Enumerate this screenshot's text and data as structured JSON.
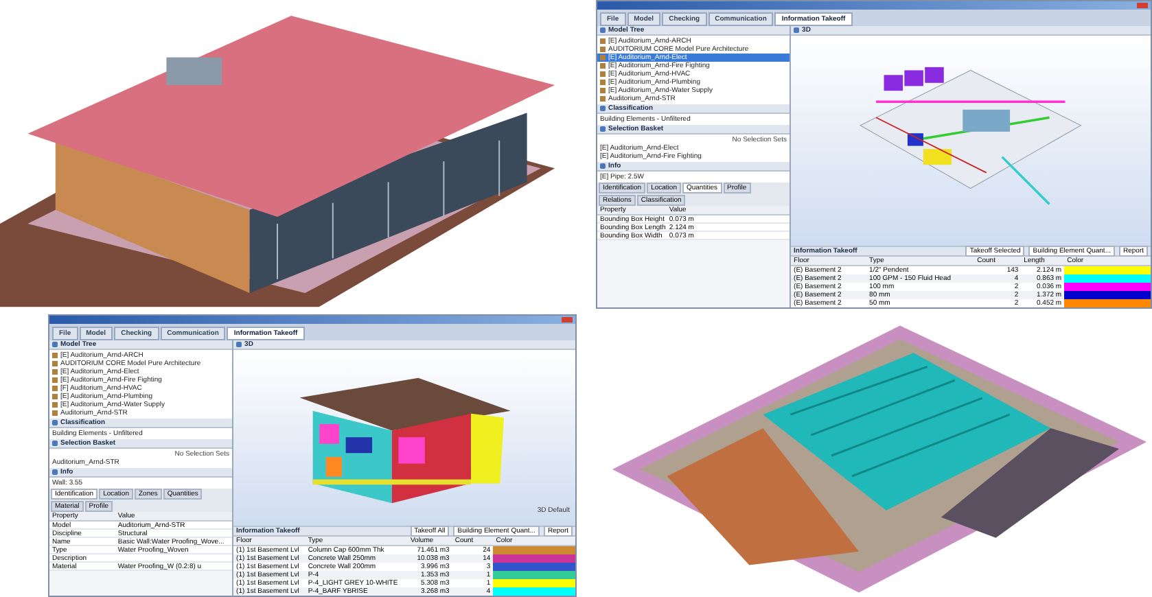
{
  "windows": [
    {
      "kind": "mep",
      "tabs": [
        {
          "label": "File",
          "selected": false
        },
        {
          "label": "Model",
          "selected": false
        },
        {
          "label": "Checking",
          "selected": false
        },
        {
          "label": "Communication",
          "selected": false
        },
        {
          "label": "Information Takeoff",
          "selected": true
        }
      ],
      "model_tree": {
        "title": "Model Tree",
        "items": [
          {
            "label": "[E] Auditorium_Arnd-ARCH",
            "selected": false
          },
          {
            "label": "AUDITORIUM CORE Model Pure Architecture",
            "selected": false
          },
          {
            "label": "[E] Auditorium_Arnd-Elect",
            "selected": true
          },
          {
            "label": "[E] Auditorium_Arnd-Fire Fighting",
            "selected": false
          },
          {
            "label": "[E] Auditorium_Arnd-HVAC",
            "selected": false
          },
          {
            "label": "[E] Auditorium_Arnd-Plumbing",
            "selected": false
          },
          {
            "label": "[E] Auditorium_Arnd-Water Supply",
            "selected": false
          },
          {
            "label": "Auditorium_Arnd-STR",
            "selected": false
          }
        ]
      },
      "classification": {
        "title": "Classification",
        "item": "Building Elements - Unfiltered"
      },
      "selection_basket": {
        "title": "Selection Basket",
        "filter": "No Selection Sets",
        "items": [
          "[E] Auditorium_Arnd-Elect",
          "[E] Auditorium_Arnd-Fire Fighting"
        ]
      },
      "info": {
        "title": "Info",
        "object": "[E] Pipe: 2.5W",
        "tabs": [
          {
            "label": "Identification",
            "selected": false
          },
          {
            "label": "Location",
            "selected": false
          },
          {
            "label": "Quantities",
            "selected": true
          },
          {
            "label": "Profile",
            "selected": false
          },
          {
            "label": "Relations",
            "selected": false
          },
          {
            "label": "Classification",
            "selected": false
          }
        ],
        "columns": [
          "Property",
          "Value"
        ],
        "rows": [
          [
            "Bounding Box Height",
            "0.073 m"
          ],
          [
            "Bounding Box Length",
            "2.124 m"
          ],
          [
            "Bounding Box Width",
            "0.073 m"
          ]
        ]
      },
      "view": {
        "title": "3D"
      },
      "takeoff": {
        "title": "Information Takeoff",
        "toolbar": [
          "Takeoff Selected",
          "Building Element Quant...",
          "Report"
        ],
        "columns": [
          "Floor",
          "Type",
          "Count",
          "Length",
          "Color"
        ],
        "rows": [
          {
            "cells": [
              "(E) Basement 2",
              "1/2\" Pendent",
              "143",
              "2.124 m"
            ],
            "color": "#ffff00"
          },
          {
            "cells": [
              "(E) Basement 2",
              "100 GPM - 150 Fluid Head",
              "4",
              "0.863 m"
            ],
            "color": "#00ffff"
          },
          {
            "cells": [
              "(E) Basement 2",
              "100 mm",
              "2",
              "0.036 m"
            ],
            "color": "#ff00ff"
          },
          {
            "cells": [
              "(E) Basement 2",
              "80 mm",
              "2",
              "1.372 m"
            ],
            "color": "#0000cc"
          },
          {
            "cells": [
              "(E) Basement 2",
              "50 mm",
              "2",
              "0.452 m"
            ],
            "color": "#ff8800"
          }
        ]
      }
    },
    {
      "kind": "building",
      "tabs": [
        {
          "label": "File",
          "selected": false
        },
        {
          "label": "Model",
          "selected": false
        },
        {
          "label": "Checking",
          "selected": false
        },
        {
          "label": "Communication",
          "selected": false
        },
        {
          "label": "Information Takeoff",
          "selected": true
        }
      ],
      "model_tree": {
        "title": "Model Tree",
        "items": [
          {
            "label": "[E] Auditorium_Arnd-ARCH",
            "selected": false
          },
          {
            "label": "AUDITORIUM CORE Model Pure Architecture",
            "selected": false
          },
          {
            "label": "[E] Auditorium_Arnd-Elect",
            "selected": false
          },
          {
            "label": "[E] Auditorium_Arnd-Fire Fighting",
            "selected": false
          },
          {
            "label": "[F] Auditorium_Arnd-HVAC",
            "selected": false
          },
          {
            "label": "[E] Auditorium_Arnd-Plumbing",
            "selected": false
          },
          {
            "label": "[E] Auditorium_Arnd-Water Supply",
            "selected": false
          },
          {
            "label": "Auditorium_Arnd-STR",
            "selected": false
          }
        ]
      },
      "classification": {
        "title": "Classification",
        "item": "Building Elements - Unfiltered"
      },
      "selection_basket": {
        "title": "Selection Basket",
        "filter": "No Selection Sets",
        "items": [
          "Auditorium_Arnd-STR"
        ]
      },
      "info": {
        "title": "Info",
        "object": "Wall: 3.55",
        "tabs": [
          {
            "label": "Identification",
            "selected": true
          },
          {
            "label": "Location",
            "selected": false
          },
          {
            "label": "Zones",
            "selected": false
          },
          {
            "label": "Quantities",
            "selected": false
          },
          {
            "label": "Material",
            "selected": false
          },
          {
            "label": "Profile",
            "selected": false
          }
        ],
        "columns": [
          "Property",
          "Value"
        ],
        "rows": [
          [
            "Model",
            "Auditorium_Arnd-STR"
          ],
          [
            "Discipline",
            "Structural"
          ],
          [
            "Name",
            "Basic Wall:Water Proofing_Wove..."
          ],
          [
            "Type",
            "Water Proofing_Woven"
          ],
          [
            "Description",
            ""
          ],
          [
            "Material",
            "Water Proofing_W (0.2:8) u"
          ]
        ]
      },
      "view": {
        "title": "3D",
        "label": "3D Default"
      },
      "takeoff": {
        "title": "Information Takeoff",
        "toolbar": [
          "Takeoff All",
          "Building Element Quant...",
          "Report"
        ],
        "columns": [
          "Floor",
          "Type",
          "Volume",
          "Count",
          "Color"
        ],
        "rows": [
          {
            "cells": [
              "(1) 1st Basement Lvl",
              "Column Cap 600mm Thk",
              "71.461 m3",
              "24"
            ],
            "color": "#cc8833"
          },
          {
            "cells": [
              "(1) 1st Basement Lvl",
              "Concrete Wall 250mm",
              "10.038 m3",
              "14"
            ],
            "color": "#cc3399"
          },
          {
            "cells": [
              "(1) 1st Basement Lvl",
              "Concrete Wall 200mm",
              "3.996 m3",
              "3"
            ],
            "color": "#3355cc"
          },
          {
            "cells": [
              "(1) 1st Basement Lvl",
              "P-4",
              "1.353 m3",
              "1"
            ],
            "color": "#33cc99"
          },
          {
            "cells": [
              "(1) 1st Basement Lvl",
              "P-4_LIGHT GREY 10-WHITE",
              "5.308 m3",
              "1"
            ],
            "color": "#ffff00"
          },
          {
            "cells": [
              "(1) 1st Basement Lvl",
              "P-4_BARF YBRISE",
              "3.268 m3",
              "4"
            ],
            "color": "#00ffff"
          }
        ]
      }
    }
  ]
}
